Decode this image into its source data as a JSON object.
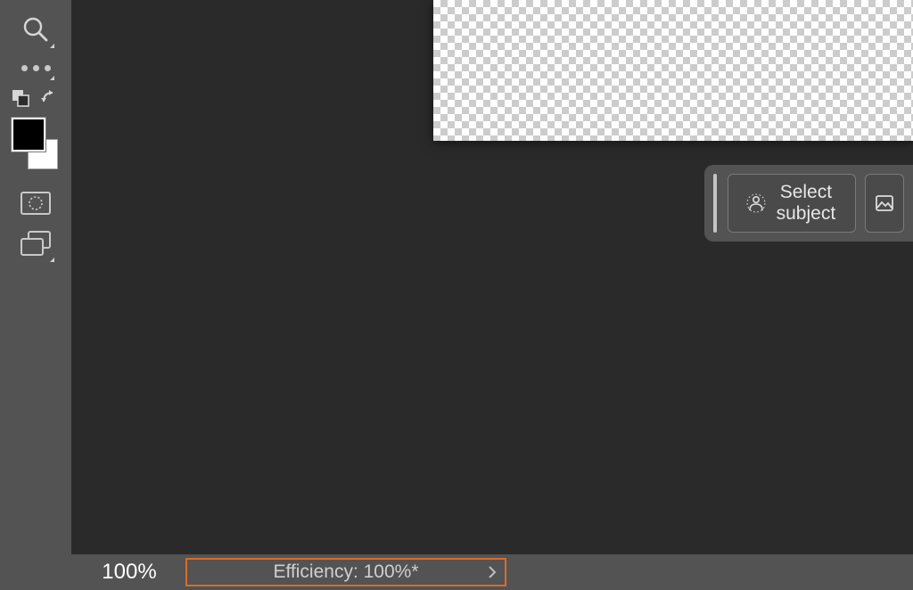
{
  "toolbar": {
    "tools": {
      "zoom": "zoom-tool",
      "more": "more-tools",
      "arrange": "edit-toolbar",
      "switch_colors": "switch-colors",
      "quick_mask": "quick-mask-mode",
      "screen_mode": "screen-mode"
    },
    "foreground_color": "#000000",
    "background_color": "#ffffff"
  },
  "context": {
    "select_subject_label": "Select subject"
  },
  "status": {
    "zoom": "100%",
    "efficiency_label": "Efficiency: 100%*"
  },
  "colors": {
    "highlight": "#d96c29",
    "panel": "#535353",
    "canvas_bg": "#2a2a2a"
  }
}
